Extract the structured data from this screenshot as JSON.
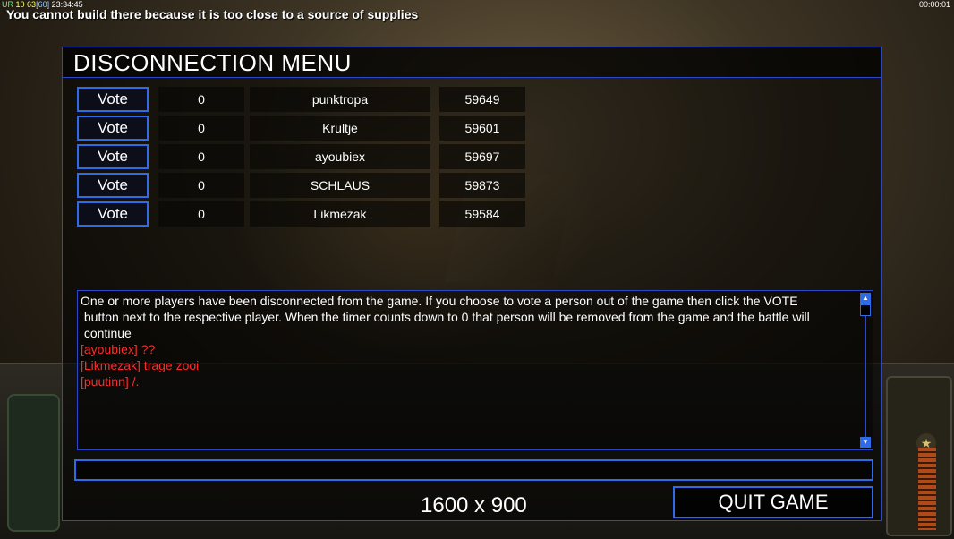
{
  "overlay": {
    "stats_parts": [
      "UR",
      "10",
      "63",
      "[60]",
      "23:34:45"
    ],
    "clock": "00:00:01",
    "message": "You cannot build there because it is too close to a source of supplies"
  },
  "menu": {
    "title": "DISCONNECTION MENU",
    "players": [
      {
        "vote_label": "Vote",
        "count": "0",
        "name": "punktropa",
        "timer": "59649"
      },
      {
        "vote_label": "Vote",
        "count": "0",
        "name": "Krultje",
        "timer": "59601"
      },
      {
        "vote_label": "Vote",
        "count": "0",
        "name": "ayoubiex",
        "timer": "59697"
      },
      {
        "vote_label": "Vote",
        "count": "0",
        "name": "SCHLAUS",
        "timer": "59873"
      },
      {
        "vote_label": "Vote",
        "count": "0",
        "name": "Likmezak",
        "timer": "59584"
      }
    ],
    "chat": {
      "system_message": "One or more players have been disconnected from the game. If you choose to vote a person out of the game then click the VOTE\n button next to the respective player. When the timer counts down to 0 that person will be removed from the game and the battle will\n continue",
      "messages": [
        "[ayoubiex] ??",
        "[Likmezak] trage zooi",
        "[puutinn] /."
      ]
    },
    "chat_input_value": "",
    "resolution": "1600 x 900",
    "quit_label": "QUIT GAME"
  },
  "colors": {
    "accent": "#2f6be8",
    "chat_red": "#ff2a2a"
  }
}
